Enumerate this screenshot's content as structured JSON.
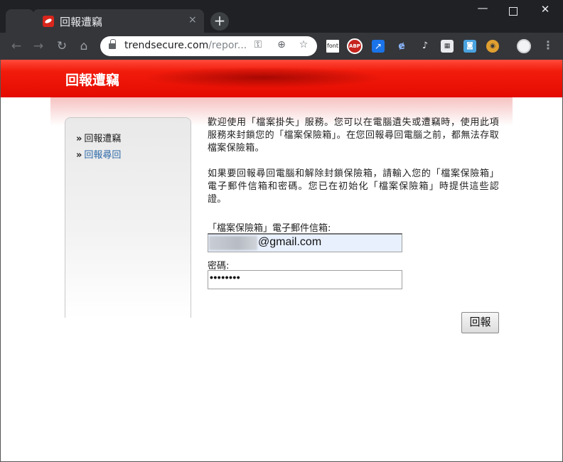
{
  "browser": {
    "tab_title": "回報遭竊",
    "tab_close": "×",
    "new_tab": "+",
    "url_host": "trendsecure.com",
    "url_path": "/repor...",
    "extensions": {
      "font": "font",
      "abp": "ABP"
    }
  },
  "banner": {
    "title": "回報遭竊"
  },
  "sidebar": {
    "items": [
      {
        "arrow": "»",
        "label": "回報遭竊"
      },
      {
        "arrow": "»",
        "label": "回報尋回"
      }
    ]
  },
  "content": {
    "intro_1": "歡迎使用「檔案掛失」服務。您可以在電腦遺失或遭竊時，使用此項服務來封鎖您的「檔案保險箱」。在您回報尋回電腦之前，都無法存取檔案保險箱。",
    "intro_2": "如果要回報尋回電腦和解除封鎖保險箱，請輸入您的「檔案保險箱」電子郵件信箱和密碼。您已在初始化「檔案保險箱」時提供這些認證。",
    "email_label": "「檔案保險箱」電子郵件信箱:",
    "email_value": "@gmail.com",
    "password_label": "密碼:",
    "password_value": "••••••••",
    "submit_label": "回報"
  },
  "colors": {
    "banner_red": "#e40a00",
    "link_blue": "#2f6aa8",
    "autofill_bg": "#e8f0fe"
  }
}
